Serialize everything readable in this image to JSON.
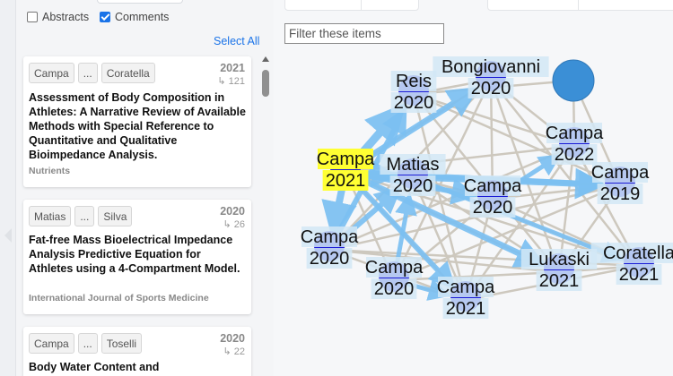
{
  "options": {
    "abstracts": {
      "label": "Abstracts",
      "checked": false
    },
    "comments": {
      "label": "Comments",
      "checked": true
    }
  },
  "select_all": "Select All",
  "filter_placeholder": "Filter these items",
  "papers": [
    {
      "authors": [
        "Campa",
        "...",
        "Coratella"
      ],
      "year": "2021",
      "cites": "↳ 121",
      "title": "Assessment of Body Composition in Athletes: A Narrative Review of Available Methods with Special Reference to Quantitative and Qualitative Bioimpedance Analysis.",
      "journal": "Nutrients"
    },
    {
      "authors": [
        "Matias",
        "...",
        "Silva"
      ],
      "year": "2020",
      "cites": "↳ 26",
      "title": "Fat-free Mass Bioelectrical Impedance Analysis Predictive Equation for Athletes using a 4-Compartment Model.",
      "journal": "International Journal of Sports Medicine"
    },
    {
      "authors": [
        "Campa",
        "...",
        "Toselli"
      ],
      "year": "2020",
      "cites": "↳ 22",
      "title": "Body Water Content and"
    }
  ],
  "graph": {
    "colors": {
      "node": "#1a1ad6",
      "highlight": "#ffff33",
      "orb": "#3b8fd6",
      "arrow": "#7cc0f2",
      "edge": "#cdc8be"
    },
    "nodes": [
      {
        "id": "bongiovanni",
        "name": "Bongiovanni",
        "year": "2020"
      },
      {
        "id": "reis",
        "name": "Reis",
        "year": "2020"
      },
      {
        "id": "campa2022",
        "name": "Campa",
        "year": "2022"
      },
      {
        "id": "campa2021a",
        "name": "Campa",
        "year": "2021",
        "selected": true
      },
      {
        "id": "matias",
        "name": "Matias",
        "year": "2020"
      },
      {
        "id": "campa2020a",
        "name": "Campa",
        "year": "2020"
      },
      {
        "id": "campa2019",
        "name": "Campa",
        "year": "2019"
      },
      {
        "id": "campa2020b",
        "name": "Campa",
        "year": "2020"
      },
      {
        "id": "lukaski",
        "name": "Lukaski",
        "year": "2021"
      },
      {
        "id": "coratella",
        "name": "Coratella",
        "year": "2021"
      },
      {
        "id": "campa2020c",
        "name": "Campa",
        "year": "2020"
      },
      {
        "id": "campa2021b",
        "name": "Campa",
        "year": "2021"
      }
    ]
  }
}
